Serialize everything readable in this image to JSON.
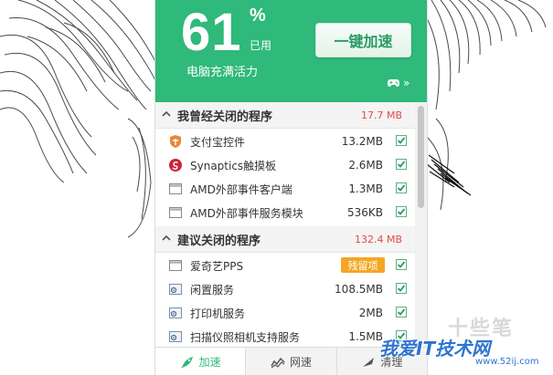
{
  "header": {
    "percent": "61",
    "percent_sign": "%",
    "used_label": "已用",
    "tagline": "电脑充满活力",
    "boost_button": "一键加速",
    "more_glyph": "»"
  },
  "sections": [
    {
      "title": "我曾经关闭的程序",
      "size": "17.7 MB",
      "items": [
        {
          "name": "支付宝控件",
          "size": "13.2MB",
          "icon": "alipay-shield-icon",
          "checked": true
        },
        {
          "name": "Synaptics触摸板",
          "size": "2.6MB",
          "icon": "synaptics-icon",
          "checked": true
        },
        {
          "name": "AMD外部事件客户端",
          "size": "1.3MB",
          "icon": "window-icon",
          "checked": true
        },
        {
          "name": "AMD外部事件服务模块",
          "size": "536KB",
          "icon": "window-icon",
          "checked": true
        }
      ]
    },
    {
      "title": "建议关闭的程序",
      "size": "132.4 MB",
      "items": [
        {
          "name": "爱奇艺PPS",
          "badge": "残留项",
          "icon": "window-icon",
          "checked": true
        },
        {
          "name": "闲置服务",
          "size": "108.5MB",
          "icon": "service-icon",
          "checked": true
        },
        {
          "name": "打印机服务",
          "size": "2MB",
          "icon": "service-icon",
          "checked": true
        },
        {
          "name": "扫描仪照相机支持服务",
          "size": "1.5MB",
          "icon": "service-icon",
          "checked": true
        }
      ]
    }
  ],
  "tabs": [
    {
      "label": "加速",
      "icon": "rocket-icon",
      "active": true
    },
    {
      "label": "网速",
      "icon": "wave-icon",
      "active": false
    },
    {
      "label": "清理",
      "icon": "broom-icon",
      "active": false
    }
  ],
  "watermark": {
    "big": "十些笔",
    "site": "我爱IT技术网",
    "url": "www.52ij.com"
  },
  "colors": {
    "accent_green": "#2fb97a",
    "size_red": "#e24b4b",
    "badge_orange": "#f5a623",
    "watermark_blue": "#2f74d0"
  }
}
